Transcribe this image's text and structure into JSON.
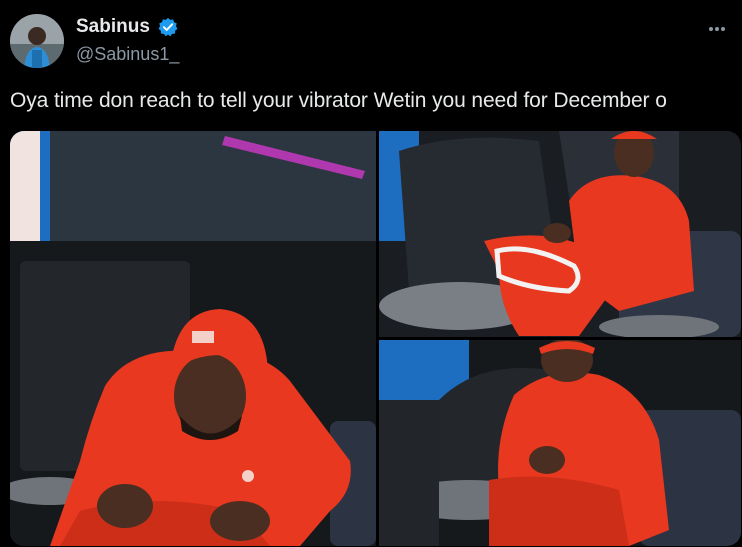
{
  "tweet": {
    "display_name": "Sabinus",
    "handle": "@Sabinus1_",
    "text": "Oya time don reach to tell your vibrator Wetin you need for December o"
  },
  "icons": {
    "verified": "verified-badge-icon",
    "more": "more-options-icon"
  },
  "colors": {
    "background": "#000000",
    "text": "#e7e9ea",
    "muted": "#8b98a5",
    "verified_blue": "#1d9bf0",
    "outfit_red": "#e8381f"
  }
}
